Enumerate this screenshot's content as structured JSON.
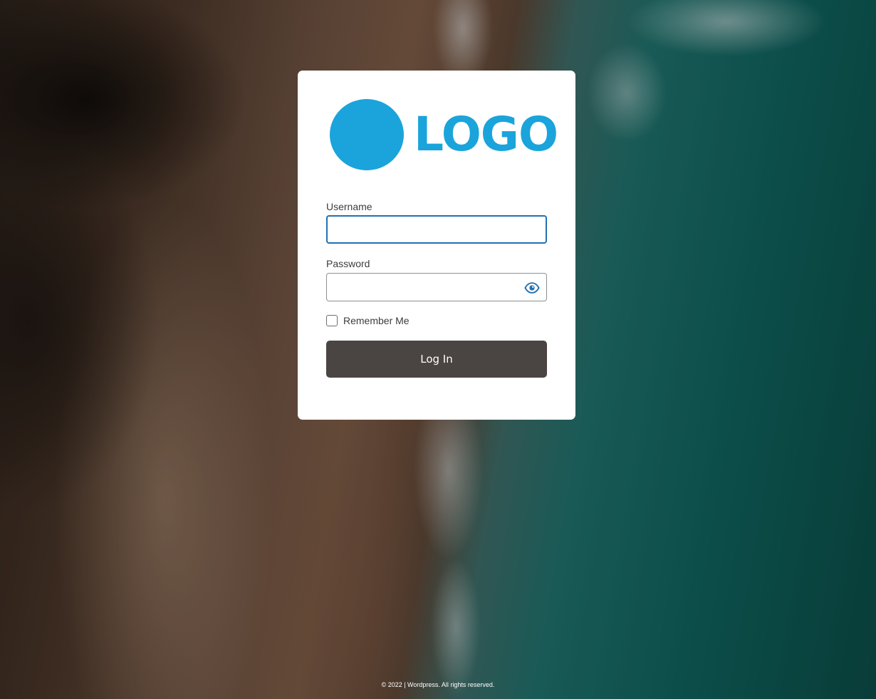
{
  "logo": {
    "text": "LOGO",
    "color": "#1aa4db"
  },
  "form": {
    "username_label": "Username",
    "username_value": "",
    "password_label": "Password",
    "password_value": "",
    "show_password_icon": "eye-icon",
    "remember_label": "Remember Me",
    "remember_checked": false,
    "submit_label": "Log In",
    "button_color": "#4a4442",
    "focus_color": "#2271b1"
  },
  "footer": {
    "text": "© 2022 | Wordpress. All rights reserved."
  }
}
